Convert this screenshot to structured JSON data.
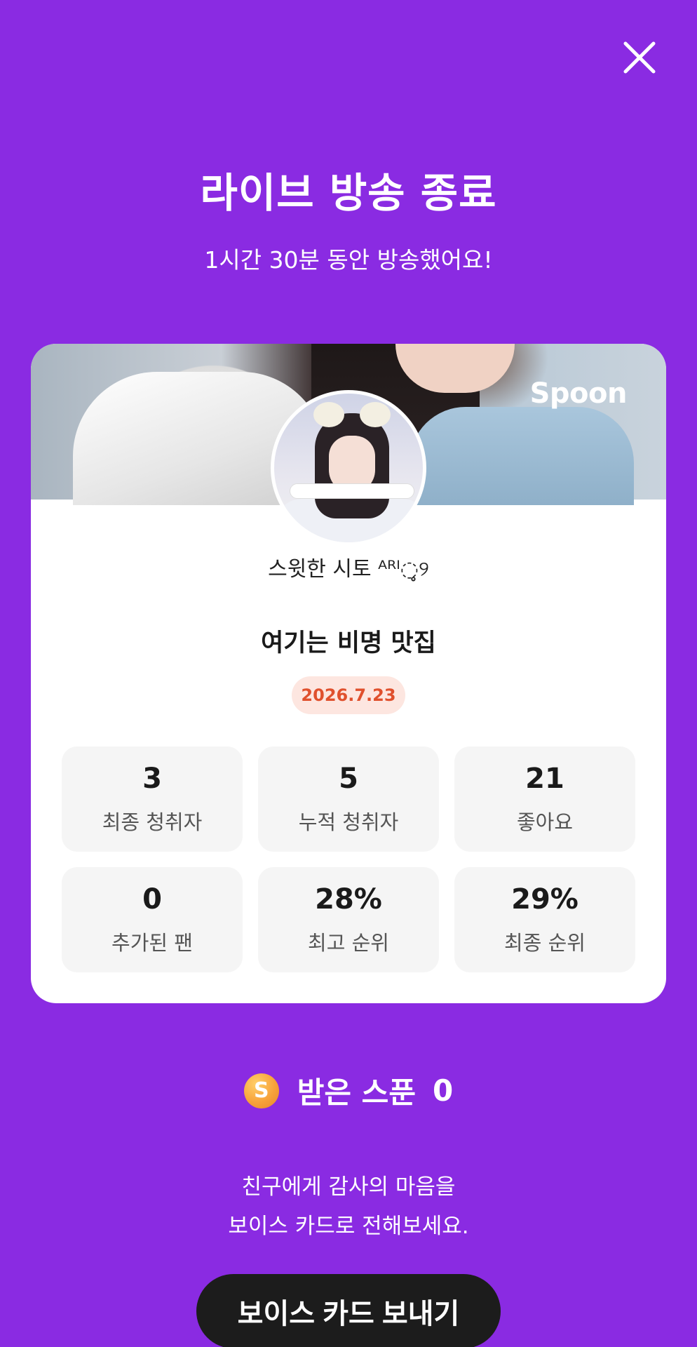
{
  "header": {
    "close_icon": "close-icon",
    "title": "라이브 방송 종료",
    "subtitle": "1시간 30분 동안 방송했어요!"
  },
  "card": {
    "brand": "Spoon",
    "nickname": "스윗한 시토 ᴬᴿᴵ◌̥୨",
    "room_title": "여기는 비명 맛집",
    "date": "2026.7.23",
    "stats": [
      {
        "value": "3",
        "label": "최종 청취자"
      },
      {
        "value": "5",
        "label": "누적 청취자"
      },
      {
        "value": "21",
        "label": "좋아요"
      },
      {
        "value": "0",
        "label": "추가된 팬"
      },
      {
        "value": "28%",
        "label": "최고 순위"
      },
      {
        "value": "29%",
        "label": "최종 순위"
      }
    ]
  },
  "spoons": {
    "coin_letter": "S",
    "label": "받은 스푼",
    "value": "0"
  },
  "message": {
    "line1": "친구에게 감사의 마음을",
    "line2": "보이스 카드로 전해보세요."
  },
  "voice_card_button": "보이스 카드 보내기",
  "colors": {
    "background": "#8a2be2",
    "badge_bg": "#fde6e0",
    "badge_text": "#e0502d",
    "button_bg": "#1c1c1c"
  }
}
